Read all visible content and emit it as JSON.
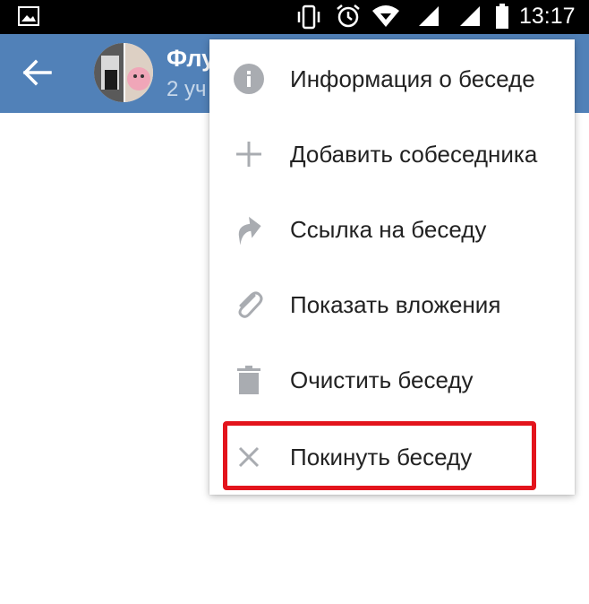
{
  "status_bar": {
    "time": "13:17",
    "icons": [
      "gallery-icon",
      "vibrate-icon",
      "alarm-icon",
      "wifi-icon",
      "signal-icon",
      "battery-icon"
    ]
  },
  "app_bar": {
    "title": "Флу",
    "subtitle": "2 уч",
    "background_color": "#5181b8"
  },
  "menu": {
    "items": [
      {
        "label": "Информация о беседе",
        "icon": "info-icon"
      },
      {
        "label": "Добавить собеседника",
        "icon": "plus-icon"
      },
      {
        "label": "Ссылка на беседу",
        "icon": "share-icon"
      },
      {
        "label": "Показать вложения",
        "icon": "paperclip-icon"
      },
      {
        "label": "Очистить беседу",
        "icon": "trash-icon"
      },
      {
        "label": "Покинуть беседу",
        "icon": "close-icon"
      }
    ],
    "highlighted_item": "Покинуть беседу",
    "highlight_color": "#e3141c"
  }
}
